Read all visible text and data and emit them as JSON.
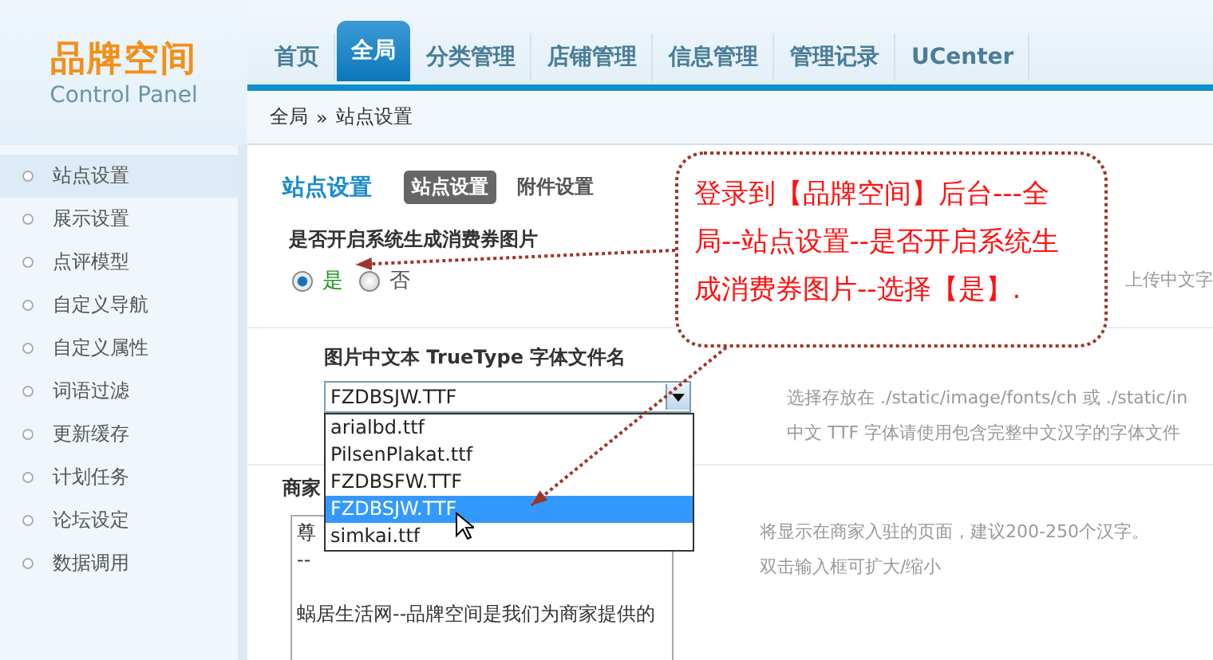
{
  "logo": {
    "title": "品牌空间",
    "subtitle": "Control Panel"
  },
  "nav": [
    {
      "label": "首页",
      "selected": false
    },
    {
      "label": "全局",
      "selected": true
    },
    {
      "label": "分类管理",
      "selected": false
    },
    {
      "label": "店铺管理",
      "selected": false
    },
    {
      "label": "信息管理",
      "selected": false
    },
    {
      "label": "管理记录",
      "selected": false
    },
    {
      "label": "UCenter",
      "selected": false
    }
  ],
  "breadcrumb": {
    "parent": "全局",
    "separator": "»",
    "current": "站点设置"
  },
  "sidebar": [
    {
      "label": "站点设置",
      "selected": true
    },
    {
      "label": "展示设置",
      "selected": false
    },
    {
      "label": "点评模型",
      "selected": false
    },
    {
      "label": "自定义导航",
      "selected": false
    },
    {
      "label": "自定义属性",
      "selected": false
    },
    {
      "label": "词语过滤",
      "selected": false
    },
    {
      "label": "更新缓存",
      "selected": false
    },
    {
      "label": "计划任务",
      "selected": false
    },
    {
      "label": "论坛设定",
      "selected": false
    },
    {
      "label": "数据调用",
      "selected": false
    }
  ],
  "page_title": "站点设置",
  "tabs": [
    {
      "label": "站点设置",
      "selected": true
    },
    {
      "label": "附件设置",
      "selected": false
    }
  ],
  "coupon_setting": {
    "label": "是否开启系统生成消费券图片",
    "options": [
      {
        "label": "是",
        "selected": true
      },
      {
        "label": "否",
        "selected": false
      }
    ],
    "hint": "上传中文字"
  },
  "font_setting": {
    "label": "图片中文本 TrueType 字体文件名",
    "value": "FZDBSJW.TTF",
    "options": [
      {
        "label": "arialbd.ttf",
        "selected": false
      },
      {
        "label": "PilsenPlakat.ttf",
        "selected": false
      },
      {
        "label": "FZDBSFW.TTF",
        "selected": false
      },
      {
        "label": "FZDBSJW.TTF",
        "selected": true
      },
      {
        "label": "simkai.ttf",
        "selected": false
      }
    ],
    "hint": [
      "选择存放在 ./static/image/fonts/ch 或 ./static/in",
      "中文 TTF 字体请使用包含完整中文汉字的字体文件"
    ]
  },
  "intro_setting": {
    "label": "商家",
    "paragraphs": [
      [
        "尊",
        "--"
      ],
      [
        "蜗居生活网--品牌空间是我们为商家提供的"
      ]
    ],
    "hint": [
      "将显示在商家入驻的页面，建议200-250个汉字。",
      "双击输入框可扩大/缩小"
    ]
  },
  "callout": {
    "text": "登录到【品牌空间】后台---全局--站点设置--是否开启系统生成消费券图片--选择【是】."
  }
}
